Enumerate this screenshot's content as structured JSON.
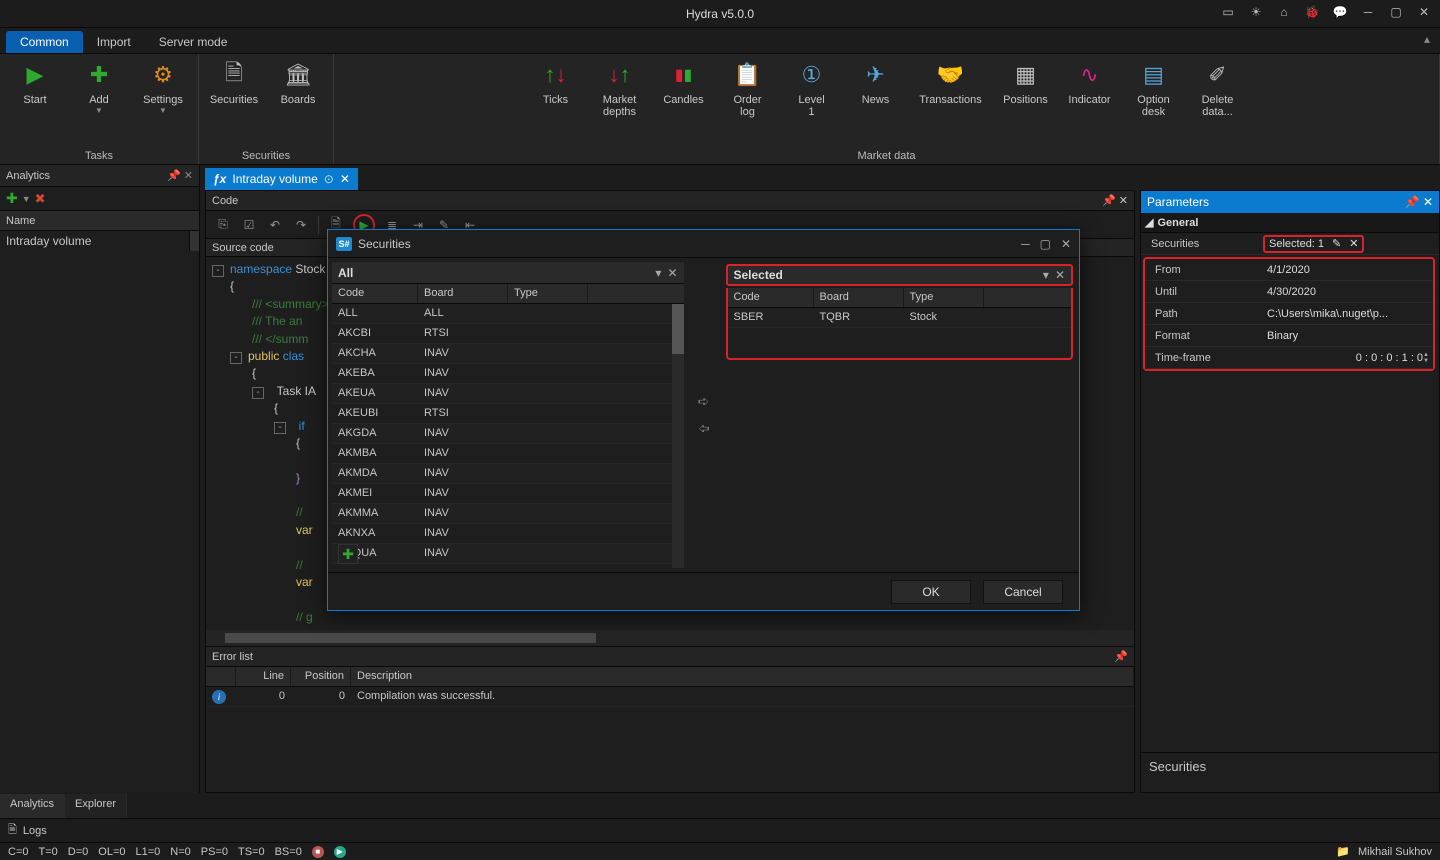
{
  "app": {
    "title": "Hydra v5.0.0"
  },
  "ribbon_tabs": [
    "Common",
    "Import",
    "Server mode"
  ],
  "ribbon_groups": {
    "tasks": {
      "label": "Tasks",
      "items": [
        "Start",
        "Add",
        "Settings"
      ]
    },
    "securities": {
      "label": "Securities",
      "items": [
        "Securities",
        "Boards"
      ]
    },
    "market": {
      "label": "Market data",
      "items": [
        "Ticks",
        "Market\ndepths",
        "Candles",
        "Order\nlog",
        "Level\n1",
        "News",
        "Transactions",
        "Positions",
        "Indicator",
        "Option\ndesk",
        "Delete\ndata..."
      ]
    }
  },
  "analytics": {
    "title": "Analytics",
    "col": "Name",
    "items": [
      "Intraday volume"
    ]
  },
  "doc_tab": {
    "label": "Intraday volume"
  },
  "center": {
    "code_title": "Code",
    "src_title": "Source code",
    "err_title": "Error list",
    "err_cols": [
      "",
      "Line",
      "Position",
      "Description"
    ],
    "err_row": {
      "line": "0",
      "pos": "0",
      "desc": "Compilation was successful."
    },
    "code_lines": [
      "namespace StockSharp",
      "{",
      "    /// <summary>",
      "    /// The analytics ...",
      "    /// </summary>",
      "    public class ...",
      "    {",
      "        Task IAnalytics.",
      "        {",
      "            if (...)",
      "            {",
      "",
      "            }",
      "",
      "            // ...",
      "            var ...",
      "",
      "            // ...",
      "            var ...",
      "",
      "            // ..."
    ]
  },
  "params": {
    "title": "Parameters",
    "group": "General",
    "rows": {
      "Securities": "Selected: 1",
      "From": "4/1/2020",
      "Until": "4/30/2020",
      "Path": "C:\\Users\\mika\\.nuget\\p...",
      "Format": "Binary",
      "Time-frame": "0 : 0 : 0 : 1 : 0"
    },
    "footer": "Securities"
  },
  "dialog": {
    "title": "Securities",
    "all_label": "All",
    "sel_label": "Selected",
    "cols": [
      "Code",
      "Board",
      "Type"
    ],
    "all_rows": [
      [
        "ALL",
        "ALL",
        ""
      ],
      [
        "AKCBI",
        "RTSI",
        ""
      ],
      [
        "AKCHA",
        "INAV",
        ""
      ],
      [
        "AKEBA",
        "INAV",
        ""
      ],
      [
        "AKEUA",
        "INAV",
        ""
      ],
      [
        "AKEUBI",
        "RTSI",
        ""
      ],
      [
        "AKGDA",
        "INAV",
        ""
      ],
      [
        "AKMBA",
        "INAV",
        ""
      ],
      [
        "AKMDA",
        "INAV",
        ""
      ],
      [
        "AKMEI",
        "INAV",
        ""
      ],
      [
        "AKMMA",
        "INAV",
        ""
      ],
      [
        "AKNXA",
        "INAV",
        ""
      ],
      [
        "AKQUA",
        "INAV",
        ""
      ]
    ],
    "sel_rows": [
      [
        "SBER",
        "TQBR",
        "Stock"
      ]
    ],
    "ok": "OK",
    "cancel": "Cancel"
  },
  "bottom_tabs": [
    "Analytics",
    "Explorer"
  ],
  "logs_label": "Logs",
  "status": {
    "left": [
      "C=0",
      "T=0",
      "D=0",
      "OL=0",
      "L1=0",
      "N=0",
      "PS=0",
      "TS=0",
      "BS=0"
    ],
    "user": "Mikhail Sukhov"
  }
}
